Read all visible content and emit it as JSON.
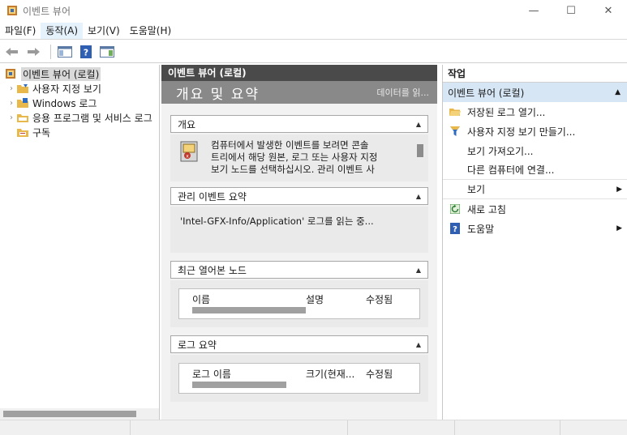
{
  "window": {
    "title": "이벤트 뷰어",
    "minimize": "—",
    "maximize": "☐",
    "close": "✕"
  },
  "menu": [
    "파일(F)",
    "동작(A)",
    "보기(V)",
    "도움말(H)"
  ],
  "tree": {
    "root": "이벤트 뷰어 (로컬)",
    "items": [
      "사용자 지정 보기",
      "Windows 로그",
      "응용 프로그램 및 서비스 로그",
      "구독"
    ]
  },
  "center": {
    "header": "이벤트 뷰어 (로컬)",
    "banner_title": "개요 및 요약",
    "banner_note": "데이터를 읽...",
    "overview": {
      "title": "개요",
      "text": "컴퓨터에서 발생한 이벤트를 보려면 콘솔\n트리에서 해당 원본, 로그 또는 사용자 지정\n보기 노드를 선택하십시오. 관리 이벤트 사"
    },
    "admin_summary": {
      "title": "관리 이벤트 요약",
      "status": "'Intel-GFX-Info/Application' 로그를 읽는 중..."
    },
    "recent_nodes": {
      "title": "최근 열어본 노드",
      "columns": [
        "이름",
        "설명",
        "수정됨"
      ]
    },
    "log_summary": {
      "title": "로그 요약",
      "columns": [
        "로그 이름",
        "크기(현재...",
        "수정됨"
      ]
    }
  },
  "actions": {
    "header": "작업",
    "group": "이벤트 뷰어 (로컬)",
    "items": [
      {
        "label": "저장된 로그 열기...",
        "icon": "folder-icon"
      },
      {
        "label": "사용자 지정 보기 만들기...",
        "icon": "filter-icon"
      },
      {
        "label": "보기 가져오기...",
        "icon": ""
      },
      {
        "label": "다른 컴퓨터에 연결...",
        "icon": ""
      },
      {
        "label": "보기",
        "icon": "",
        "submenu": true
      },
      {
        "label": "새로 고침",
        "icon": "refresh-icon"
      },
      {
        "label": "도움말",
        "icon": "help-icon",
        "submenu": true
      }
    ]
  }
}
